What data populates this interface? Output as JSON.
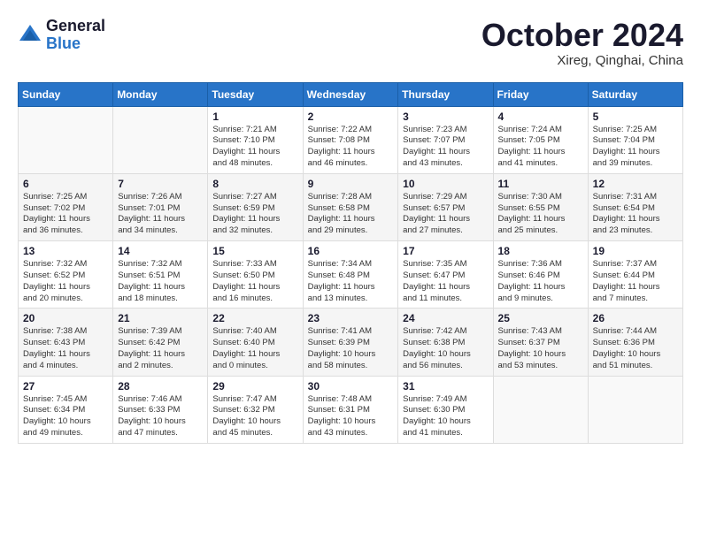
{
  "logo": {
    "general": "General",
    "blue": "Blue"
  },
  "title": {
    "month": "October 2024",
    "location": "Xireg, Qinghai, China"
  },
  "headers": [
    "Sunday",
    "Monday",
    "Tuesday",
    "Wednesday",
    "Thursday",
    "Friday",
    "Saturday"
  ],
  "weeks": [
    [
      {
        "day": "",
        "info": ""
      },
      {
        "day": "",
        "info": ""
      },
      {
        "day": "1",
        "info": "Sunrise: 7:21 AM\nSunset: 7:10 PM\nDaylight: 11 hours\nand 48 minutes."
      },
      {
        "day": "2",
        "info": "Sunrise: 7:22 AM\nSunset: 7:08 PM\nDaylight: 11 hours\nand 46 minutes."
      },
      {
        "day": "3",
        "info": "Sunrise: 7:23 AM\nSunset: 7:07 PM\nDaylight: 11 hours\nand 43 minutes."
      },
      {
        "day": "4",
        "info": "Sunrise: 7:24 AM\nSunset: 7:05 PM\nDaylight: 11 hours\nand 41 minutes."
      },
      {
        "day": "5",
        "info": "Sunrise: 7:25 AM\nSunset: 7:04 PM\nDaylight: 11 hours\nand 39 minutes."
      }
    ],
    [
      {
        "day": "6",
        "info": "Sunrise: 7:25 AM\nSunset: 7:02 PM\nDaylight: 11 hours\nand 36 minutes."
      },
      {
        "day": "7",
        "info": "Sunrise: 7:26 AM\nSunset: 7:01 PM\nDaylight: 11 hours\nand 34 minutes."
      },
      {
        "day": "8",
        "info": "Sunrise: 7:27 AM\nSunset: 6:59 PM\nDaylight: 11 hours\nand 32 minutes."
      },
      {
        "day": "9",
        "info": "Sunrise: 7:28 AM\nSunset: 6:58 PM\nDaylight: 11 hours\nand 29 minutes."
      },
      {
        "day": "10",
        "info": "Sunrise: 7:29 AM\nSunset: 6:57 PM\nDaylight: 11 hours\nand 27 minutes."
      },
      {
        "day": "11",
        "info": "Sunrise: 7:30 AM\nSunset: 6:55 PM\nDaylight: 11 hours\nand 25 minutes."
      },
      {
        "day": "12",
        "info": "Sunrise: 7:31 AM\nSunset: 6:54 PM\nDaylight: 11 hours\nand 23 minutes."
      }
    ],
    [
      {
        "day": "13",
        "info": "Sunrise: 7:32 AM\nSunset: 6:52 PM\nDaylight: 11 hours\nand 20 minutes."
      },
      {
        "day": "14",
        "info": "Sunrise: 7:32 AM\nSunset: 6:51 PM\nDaylight: 11 hours\nand 18 minutes."
      },
      {
        "day": "15",
        "info": "Sunrise: 7:33 AM\nSunset: 6:50 PM\nDaylight: 11 hours\nand 16 minutes."
      },
      {
        "day": "16",
        "info": "Sunrise: 7:34 AM\nSunset: 6:48 PM\nDaylight: 11 hours\nand 13 minutes."
      },
      {
        "day": "17",
        "info": "Sunrise: 7:35 AM\nSunset: 6:47 PM\nDaylight: 11 hours\nand 11 minutes."
      },
      {
        "day": "18",
        "info": "Sunrise: 7:36 AM\nSunset: 6:46 PM\nDaylight: 11 hours\nand 9 minutes."
      },
      {
        "day": "19",
        "info": "Sunrise: 7:37 AM\nSunset: 6:44 PM\nDaylight: 11 hours\nand 7 minutes."
      }
    ],
    [
      {
        "day": "20",
        "info": "Sunrise: 7:38 AM\nSunset: 6:43 PM\nDaylight: 11 hours\nand 4 minutes."
      },
      {
        "day": "21",
        "info": "Sunrise: 7:39 AM\nSunset: 6:42 PM\nDaylight: 11 hours\nand 2 minutes."
      },
      {
        "day": "22",
        "info": "Sunrise: 7:40 AM\nSunset: 6:40 PM\nDaylight: 11 hours\nand 0 minutes."
      },
      {
        "day": "23",
        "info": "Sunrise: 7:41 AM\nSunset: 6:39 PM\nDaylight: 10 hours\nand 58 minutes."
      },
      {
        "day": "24",
        "info": "Sunrise: 7:42 AM\nSunset: 6:38 PM\nDaylight: 10 hours\nand 56 minutes."
      },
      {
        "day": "25",
        "info": "Sunrise: 7:43 AM\nSunset: 6:37 PM\nDaylight: 10 hours\nand 53 minutes."
      },
      {
        "day": "26",
        "info": "Sunrise: 7:44 AM\nSunset: 6:36 PM\nDaylight: 10 hours\nand 51 minutes."
      }
    ],
    [
      {
        "day": "27",
        "info": "Sunrise: 7:45 AM\nSunset: 6:34 PM\nDaylight: 10 hours\nand 49 minutes."
      },
      {
        "day": "28",
        "info": "Sunrise: 7:46 AM\nSunset: 6:33 PM\nDaylight: 10 hours\nand 47 minutes."
      },
      {
        "day": "29",
        "info": "Sunrise: 7:47 AM\nSunset: 6:32 PM\nDaylight: 10 hours\nand 45 minutes."
      },
      {
        "day": "30",
        "info": "Sunrise: 7:48 AM\nSunset: 6:31 PM\nDaylight: 10 hours\nand 43 minutes."
      },
      {
        "day": "31",
        "info": "Sunrise: 7:49 AM\nSunset: 6:30 PM\nDaylight: 10 hours\nand 41 minutes."
      },
      {
        "day": "",
        "info": ""
      },
      {
        "day": "",
        "info": ""
      }
    ]
  ]
}
